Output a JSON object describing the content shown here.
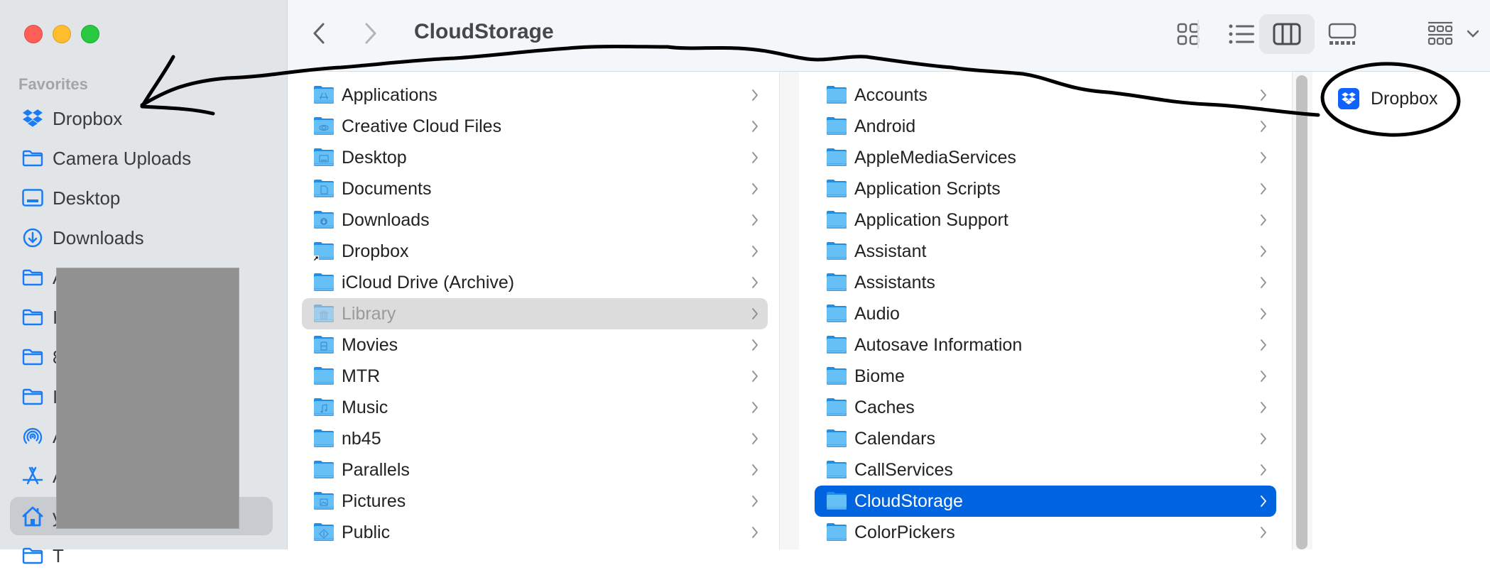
{
  "window": {
    "title": "CloudStorage",
    "controls": {
      "close": "close",
      "minimize": "minimize",
      "zoom": "zoom"
    }
  },
  "toolbar": {
    "back_icon": "chevron-left-icon",
    "forward_icon": "chevron-right-icon",
    "view_modes": [
      {
        "name": "icon-view",
        "icon": "grid-icon",
        "active": false
      },
      {
        "name": "list-view",
        "icon": "list-icon",
        "active": false
      },
      {
        "name": "column-view",
        "icon": "columns-icon",
        "active": true
      },
      {
        "name": "gallery-view",
        "icon": "gallery-icon",
        "active": false
      }
    ],
    "group_icon": "group-by-icon",
    "group_dropdown_icon": "chevron-down-icon"
  },
  "sidebar": {
    "section_heading": "Favorites",
    "items": [
      {
        "label": "Dropbox",
        "icon": "dropbox-icon"
      },
      {
        "label": "Camera Uploads",
        "icon": "folder-icon"
      },
      {
        "label": "Desktop",
        "icon": "desktop-icon"
      },
      {
        "label": "Downloads",
        "icon": "downloads-icon"
      },
      {
        "label": "A",
        "icon": "folder-icon"
      },
      {
        "label": "I",
        "icon": "folder-icon"
      },
      {
        "label": "8",
        "icon": "folder-icon"
      },
      {
        "label": "I",
        "icon": "folder-icon"
      },
      {
        "label": "A",
        "icon": "airdrop-icon"
      },
      {
        "label": "A",
        "icon": "applications-icon"
      },
      {
        "label": "y",
        "icon": "home-icon",
        "selected": true
      },
      {
        "label": "T",
        "icon": "folder-icon"
      }
    ],
    "redacted": true
  },
  "columns": [
    {
      "items": [
        {
          "label": "Applications",
          "glyph": "A"
        },
        {
          "label": "Creative Cloud Files",
          "glyph": "cc"
        },
        {
          "label": "Desktop",
          "glyph": "desktop"
        },
        {
          "label": "Documents",
          "glyph": "doc"
        },
        {
          "label": "Downloads",
          "glyph": "down"
        },
        {
          "label": "Dropbox",
          "glyph": "alias"
        },
        {
          "label": "iCloud Drive (Archive)",
          "glyph": ""
        },
        {
          "label": "Library",
          "glyph": "library",
          "state": "selected-inactive"
        },
        {
          "label": "Movies",
          "glyph": "film"
        },
        {
          "label": "MTR",
          "glyph": ""
        },
        {
          "label": "Music",
          "glyph": "note"
        },
        {
          "label": "nb45",
          "glyph": ""
        },
        {
          "label": "Parallels",
          "glyph": ""
        },
        {
          "label": "Pictures",
          "glyph": "picture"
        },
        {
          "label": "Public",
          "glyph": "public"
        }
      ]
    },
    {
      "items": [
        {
          "label": "Accounts"
        },
        {
          "label": "Android"
        },
        {
          "label": "AppleMediaServices"
        },
        {
          "label": "Application Scripts"
        },
        {
          "label": "Application Support"
        },
        {
          "label": "Assistant"
        },
        {
          "label": "Assistants"
        },
        {
          "label": "Audio"
        },
        {
          "label": "Autosave Information"
        },
        {
          "label": "Biome"
        },
        {
          "label": "Caches"
        },
        {
          "label": "Calendars"
        },
        {
          "label": "CallServices"
        },
        {
          "label": "CloudStorage",
          "state": "selected"
        },
        {
          "label": "ColorPickers"
        }
      ]
    },
    {
      "items": [
        {
          "label": "Dropbox",
          "icon": "dropbox-app-icon"
        }
      ]
    }
  ],
  "colors": {
    "accent": "#0064e1",
    "sidebar_bg": "#e1e5e8",
    "toolbar_bg": "#f3f7fa",
    "icon_blue": "#1a7cf5",
    "folder_blue": "#5ab6f2",
    "annotation": "#000000"
  },
  "annotation": {
    "description": "Hand-drawn arrow from circled Dropbox item to sidebar Dropbox favorite"
  }
}
